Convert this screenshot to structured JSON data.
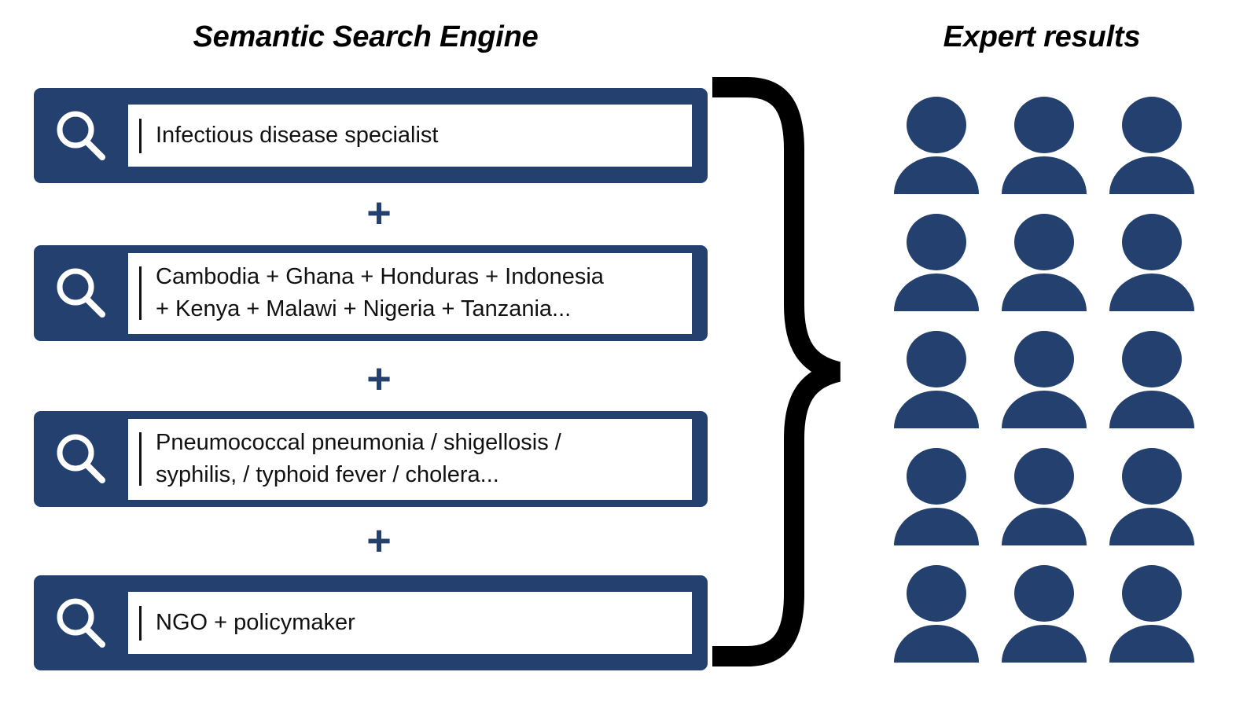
{
  "headings": {
    "left": "Semantic Search Engine",
    "right": "Expert results"
  },
  "colors": {
    "brand_blue": "#24406E",
    "brace_black": "#000000",
    "field_white": "#FFFFFF",
    "background": "#FFFFFF"
  },
  "search_panel": {
    "icon_name": "search-icon",
    "separator_label": "+",
    "bars": [
      {
        "id": "query-1",
        "icon": "search-icon",
        "value": "Infectious disease specialist",
        "placeholder": "Search"
      },
      {
        "id": "query-2",
        "icon": "search-icon",
        "value": "Cambodia + Ghana + Honduras + Indonesia\n+ Kenya + Malawi + Nigeria + Tanzania...",
        "placeholder": "Search"
      },
      {
        "id": "query-3",
        "icon": "search-icon",
        "value": "Pneumococcal pneumonia / shigellosis /\nsyphilis, / typhoid fever / cholera...",
        "placeholder": "Search"
      },
      {
        "id": "query-4",
        "icon": "search-icon",
        "value": "NGO + policymaker",
        "placeholder": "Search"
      }
    ],
    "separators": [
      "+",
      "+",
      "+"
    ]
  },
  "connector": {
    "name": "curly-brace",
    "direction": "right",
    "color": "#000000"
  },
  "results": {
    "icon_name": "person-icon",
    "rows": 5,
    "columns": 3,
    "count": 15,
    "color": "#24406E",
    "items": [
      "expert-1",
      "expert-2",
      "expert-3",
      "expert-4",
      "expert-5",
      "expert-6",
      "expert-7",
      "expert-8",
      "expert-9",
      "expert-10",
      "expert-11",
      "expert-12",
      "expert-13",
      "expert-14",
      "expert-15"
    ]
  }
}
